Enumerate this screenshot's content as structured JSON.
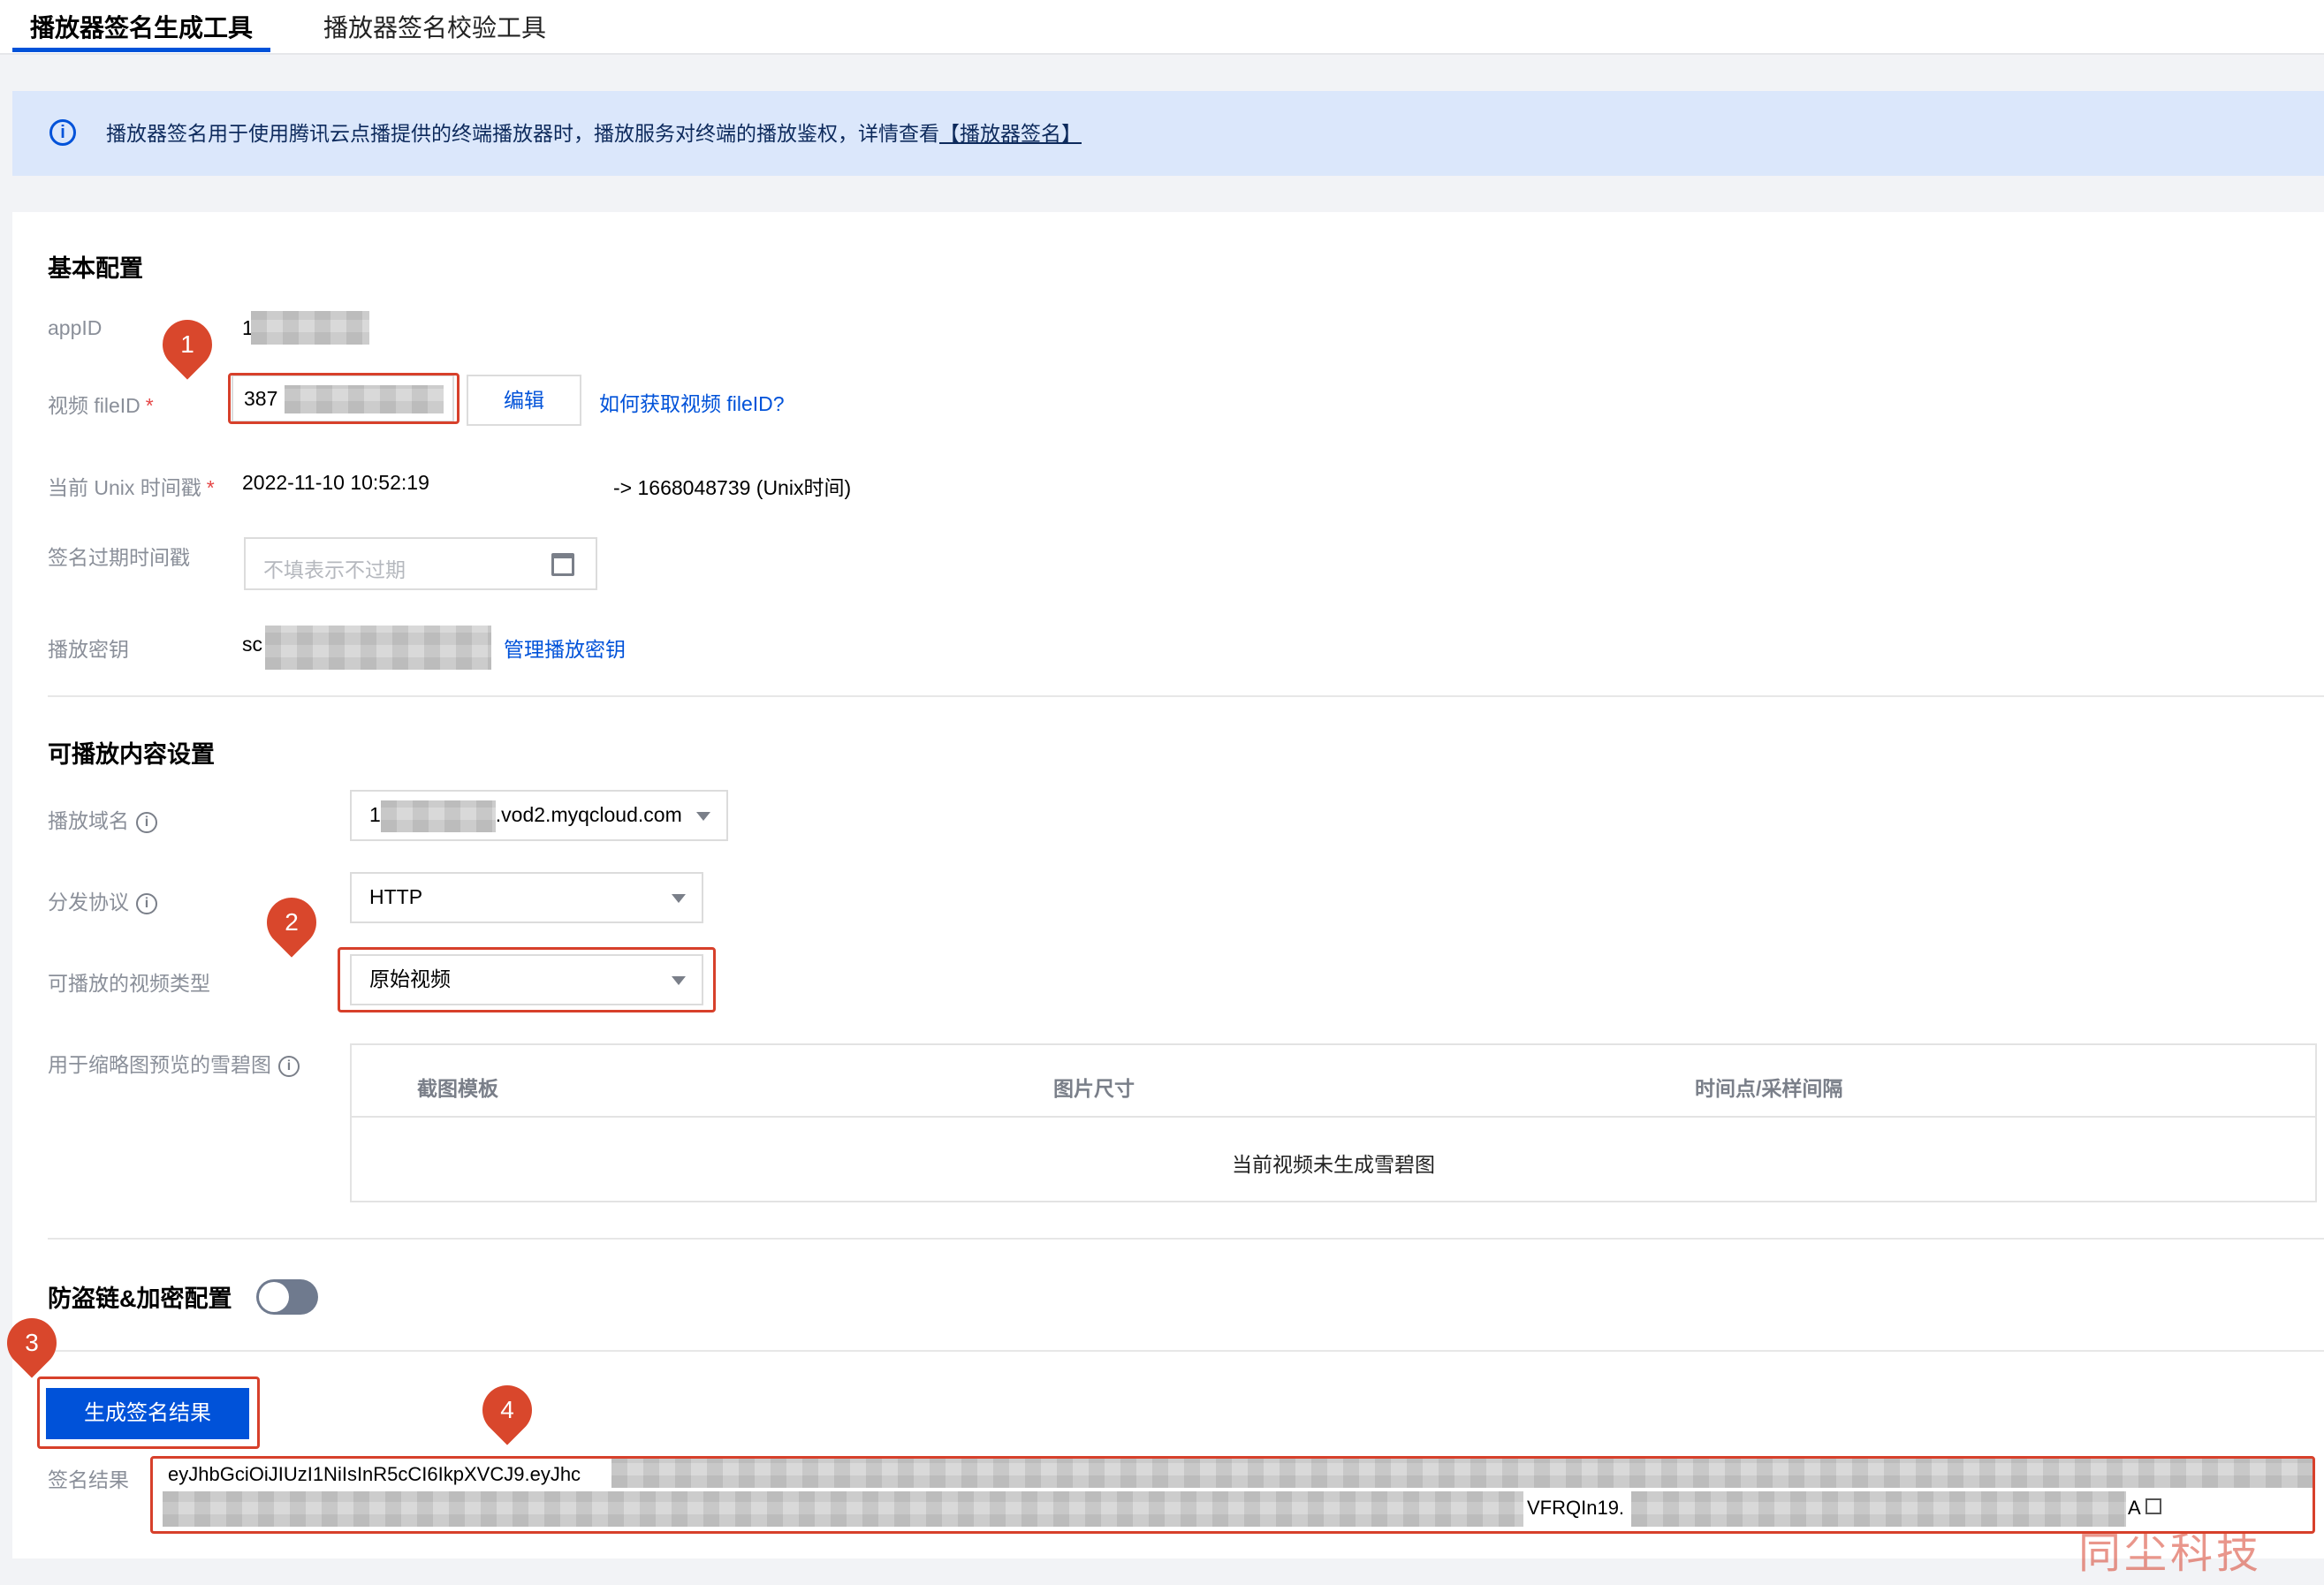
{
  "tabs": [
    {
      "label": "播放器签名生成工具",
      "active": true
    },
    {
      "label": "播放器签名校验工具",
      "active": false
    }
  ],
  "banner": {
    "icon": "info-icon",
    "text": "播放器签名用于使用腾讯云点播提供的终端播放器时，播放服务对终端的播放鉴权，详情查看",
    "link": "【播放器签名】"
  },
  "basic": {
    "title": "基本配置",
    "appid_label": "appID",
    "appid_value": "1",
    "fileid_label": "视频 fileID",
    "fileid_required": "*",
    "fileid_value": "387",
    "edit_button": "编辑",
    "how_to_link": "如何获取视频 fileID?",
    "unix_label": "当前 Unix 时间戳",
    "unix_required": "*",
    "unix_datetime": "2022-11-10 10:52:19",
    "unix_value": "-> 1668048739 (Unix时间)",
    "expire_label": "签名过期时间戳",
    "expire_placeholder": "不填表示不过期",
    "key_label": "播放密钥",
    "key_value": "sc",
    "key_manage_link": "管理播放密钥"
  },
  "content": {
    "title": "可播放内容设置",
    "domain_label": "播放域名",
    "domain_value": "1",
    "domain_suffix": ".vod2.myqcloud.com",
    "protocol_label": "分发协议",
    "protocol_value": "HTTP",
    "type_label": "可播放的视频类型",
    "type_value": "原始视频",
    "sprite_label": "用于缩略图预览的雪碧图",
    "table_headers": [
      "截图模板",
      "图片尺寸",
      "时间点/采样间隔"
    ],
    "table_empty": "当前视频未生成雪碧图"
  },
  "security": {
    "title": "防盗链&加密配置",
    "toggle_on": false
  },
  "generate_button": "生成签名结果",
  "result": {
    "label": "签名结果",
    "line1": "eyJhbGciOiJIUzI1NiIsInR5cCI6IkpXVCJ9.eyJhc",
    "line2_mid": "VFRQIn19.",
    "line2_end": "A"
  },
  "markers": [
    "1",
    "2",
    "3",
    "4"
  ],
  "watermark": "同尘科技",
  "colors": {
    "primary": "#0052d9",
    "annotation_red": "#d7402b",
    "banner_bg": "#dbe7fb"
  }
}
